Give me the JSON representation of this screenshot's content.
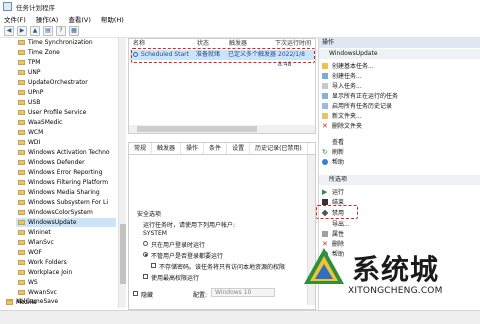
{
  "window": {
    "title": "任务计划程序"
  },
  "menu": [
    "文件(F)",
    "操作(A)",
    "查看(V)",
    "帮助(H)"
  ],
  "tree": {
    "items": [
      "Time Synchronization",
      "Time Zone",
      "TPM",
      "UNP",
      "UpdateOrchestrator",
      "UPnP",
      "USB",
      "User Profile Service",
      "WaaSMedic",
      "WCM",
      "WDI",
      "Windows Activation Techno",
      "Windows Defender",
      "Windows Error Reporting",
      "Windows Filtering Platform",
      "Windows Media Sharing",
      "Windows Subsystem For Li",
      "WindowsColorSystem",
      "WindowsUpdate",
      "Wininet",
      "WlanSvc",
      "WOF",
      "Work Folders",
      "Workplace Join",
      "WS",
      "WwanSvc"
    ],
    "selected_index": 18,
    "bottom_items": [
      "XblGameSave",
      "Mozilla"
    ]
  },
  "tasklist": {
    "headers": [
      "名称",
      "状态",
      "触发器",
      "下次运行时间"
    ],
    "row": {
      "name": "Scheduled Start",
      "status": "准备就绪",
      "trigger": "已定义多个触发器",
      "next": "2022/1/8 8:48"
    }
  },
  "details": {
    "tabs": [
      "常规",
      "触发器",
      "操作",
      "条件",
      "设置",
      "历史记录(已禁用)"
    ],
    "security_title": "安全选项",
    "run_as_label": "运行任务时，请使用下列用户帐户:",
    "run_as_value": "SYSTEM",
    "opt_logged_on": "只在用户登录时运行",
    "opt_whether": "不管用户是否登录都要运行",
    "opt_no_password": "不存储密码。该任务将只有访问本地资源的权限",
    "opt_highest": "使用最高权限运行",
    "hidden_label": "隐藏",
    "config_label": "配置:",
    "config_value": "Windows 10"
  },
  "actions": {
    "header": "操作",
    "section1": "WindowsUpdate",
    "items1": [
      "创建基本任务...",
      "创建任务...",
      "导入任务...",
      "显示所有正在运行的任务",
      "启用所有任务历史记录",
      "新文件夹...",
      "删除文件夹",
      "查看",
      "刷新",
      "帮助"
    ],
    "section2": "所选项",
    "items2": [
      "运行",
      "结束",
      "禁用",
      "导出...",
      "属性",
      "删除",
      "帮助"
    ]
  },
  "watermark": {
    "title": "系统城",
    "url": "XITONGCHENG.COM"
  },
  "colors": {
    "selection": "#cce4f7",
    "highlight_dash": "#e0201b",
    "panel_header": "#dfe8f2"
  }
}
